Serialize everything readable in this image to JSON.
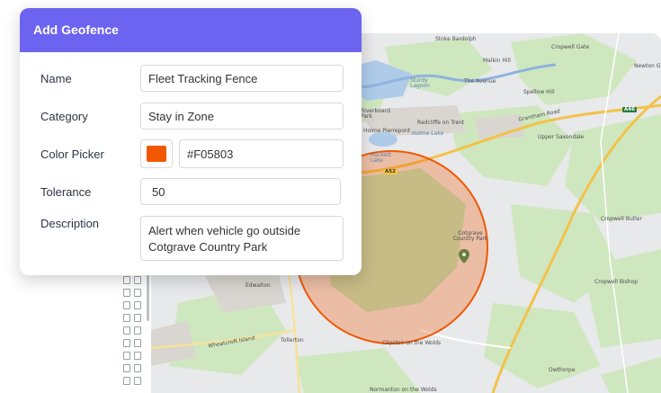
{
  "panel": {
    "title": "Add Geofence",
    "accent": "#6C63F0",
    "fields": {
      "name": {
        "label": "Name",
        "value": "Fleet Tracking Fence"
      },
      "category": {
        "label": "Category",
        "value": "Stay in Zone"
      },
      "color": {
        "label": "Color Picker",
        "value": "#F05803"
      },
      "tolerance": {
        "label": "Tolerance",
        "value": "50"
      },
      "description": {
        "label": "Description",
        "value": "Alert when vehicle go outside Cotgrave Country Park"
      }
    }
  },
  "map": {
    "geofence_color": "#F05803",
    "labels": {
      "stoke_bardolph": "Stoke Bardolph",
      "cropwell_gate": "Cropwell Gate",
      "newton": "Newton G",
      "malkin_hill": "Malkin Hill",
      "the_avenue": "The Avenue",
      "spellow_hill": "Spellow Hill",
      "grantham_road": "Grantham Road",
      "radcliffe": "Radcliffe on Trent",
      "holme_pierrepont": "Holme Pierrepont",
      "upper_saxondale": "Upper Saxondale",
      "cotgrave_park": "Cotgrave Country Park",
      "cropwell_butler": "Cropwell Butler",
      "edwalton": "Edwalton",
      "cropwell_bishop": "Cropwell Bishop",
      "wheatcroft_island": "Wheatcroft Island",
      "tollerton": "Tollerton",
      "clipston": "Clipston on the Wolds",
      "owthorpe": "Owthorpe",
      "normanton": "Normanton on the Wolds",
      "holme_lake": "Holme Lake",
      "hackett_lake": "Hackett Lake",
      "sturdy_lagoon": "Sturdy Lagoon",
      "riverboard_park": "Riverboard Park",
      "a52": "A52",
      "a46": "A46"
    }
  }
}
